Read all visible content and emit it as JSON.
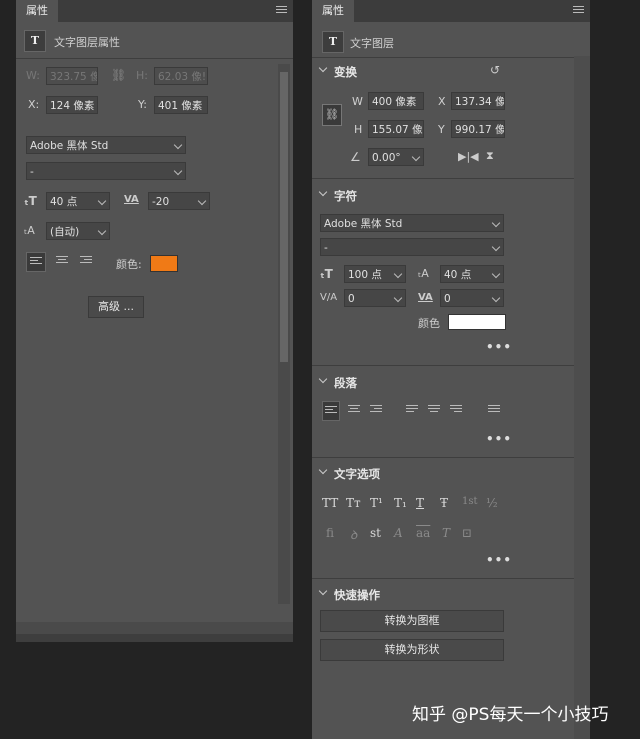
{
  "left": {
    "tab": "属性",
    "header_title": "文字图层属性",
    "header_icon": "T",
    "w_label": "W:",
    "w_value": "323.75 像!",
    "h_label": "H:",
    "h_value": "62.03 像!",
    "x_label": "X:",
    "x_value": "124 像素",
    "y_label": "Y:",
    "y_value": "401 像素",
    "font_family": "Adobe 黑体 Std",
    "font_style": "-",
    "font_size": "40 点",
    "tracking": "-20",
    "leading": "(自动)",
    "color_label": "颜色:",
    "color": "#f07a16",
    "advanced_button": "高级 ..."
  },
  "right": {
    "tab": "属性",
    "header_title": "文字图层",
    "header_icon": "T",
    "transform": {
      "title": "变换",
      "w_label": "W",
      "w_value": "400 像素",
      "x_label": "X",
      "x_value": "137.34 像!",
      "h_label": "H",
      "h_value": "155.07 像!",
      "y_label": "Y",
      "y_value": "990.17 像!",
      "angle": "0.00°"
    },
    "character": {
      "title": "字符",
      "font_family": "Adobe 黑体 Std",
      "font_style": "-",
      "font_size": "100 点",
      "leading": "40 点",
      "kerning": "0",
      "tracking": "0",
      "color_label": "颜色",
      "color": "#ffffff",
      "more": "•••"
    },
    "paragraph": {
      "title": "段落",
      "more": "•••"
    },
    "type_options": {
      "title": "文字选项",
      "row1": [
        "TT",
        "Tт",
        "T¹",
        "T₁",
        "T",
        "Ŧ",
        "1st",
        "½"
      ],
      "row2": [
        "fi",
        "ꝺ",
        "st",
        "A",
        "aa",
        "T",
        "⊡"
      ],
      "more": "•••"
    },
    "quick_actions": {
      "title": "快速操作",
      "button1": "转换为图框",
      "button2": "转换为形状"
    }
  },
  "watermark": "知乎 @PS每天一个小技巧"
}
